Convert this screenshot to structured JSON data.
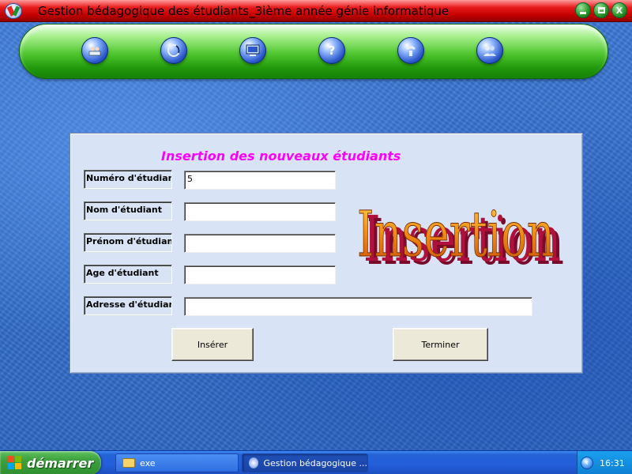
{
  "window": {
    "title": "Gestion bédagogique des étudiants_3ième année génie informatique",
    "buttons": {
      "minimize": "",
      "maximize": "",
      "close": "X"
    }
  },
  "toolbar": {
    "icons": [
      {
        "name": "students-icon"
      },
      {
        "name": "search-icon"
      },
      {
        "name": "computer-icon"
      },
      {
        "name": "help-icon"
      },
      {
        "name": "phone-icon"
      },
      {
        "name": "users-icon"
      }
    ]
  },
  "form": {
    "title": "Insertion des nouveaux étudiants",
    "fields": [
      {
        "label": "Numéro d'étudiant",
        "value": "5"
      },
      {
        "label": "Nom d'étudiant",
        "value": ""
      },
      {
        "label": "Prénom d'étudiant",
        "value": ""
      },
      {
        "label": "Age d'étudiant",
        "value": ""
      },
      {
        "label": "Adresse d'étudiant",
        "value": ""
      }
    ],
    "insert_button": "Insérer",
    "finish_button": "Terminer",
    "wordart": "Insertion"
  },
  "taskbar": {
    "start_label": "démarrer",
    "items": [
      {
        "label": "exe",
        "icon": "folder-icon"
      },
      {
        "label": "Gestion bédagogique ...",
        "icon": "app-icon"
      }
    ],
    "clock": "16:31"
  },
  "colors": {
    "title_bar": "#e81b1b",
    "toolbar_green": "#4fc52e",
    "panel_bg": "#d8e3f6",
    "form_title": "#ff00ff",
    "desktop_blue": "#2f6bc9"
  }
}
